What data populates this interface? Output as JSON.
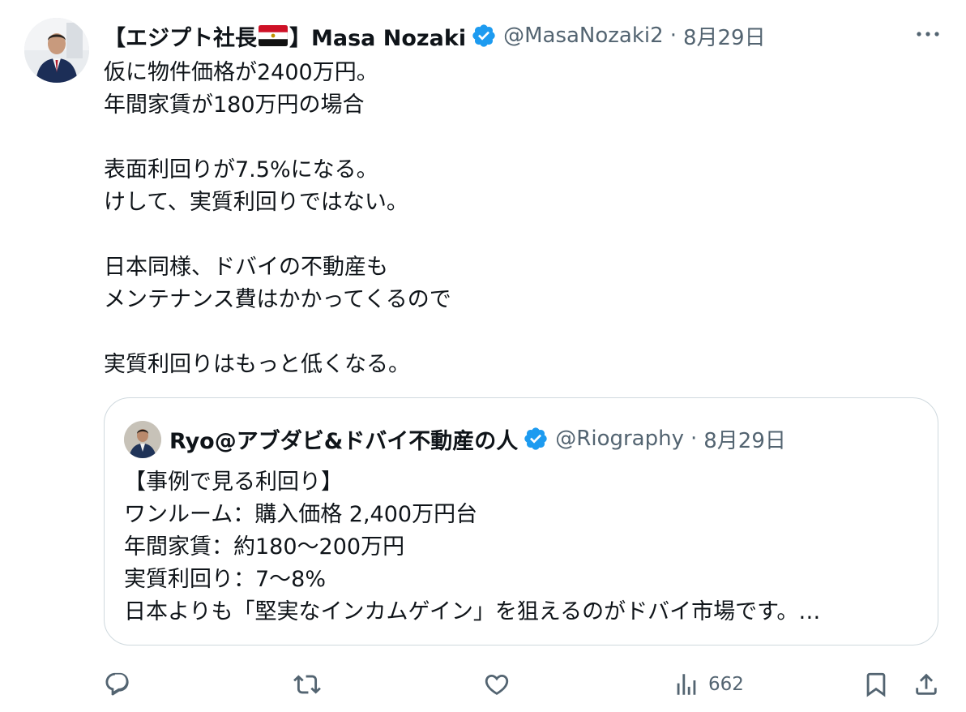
{
  "author": {
    "name_prefix": "【エジプト社長",
    "name_suffix": "】Masa Nozaki",
    "handle": "@MasaNozaki2",
    "separator": "·",
    "date": "8月29日"
  },
  "tweet": {
    "lines": [
      "仮に物件価格が2400万円。",
      "年間家賃が180万円の場合",
      "",
      "表面利回りが7.5%になる。",
      "けして、実質利回りではない。",
      "",
      "日本同様、ドバイの不動産も",
      "メンテナンス費はかかってくるので",
      "",
      "実質利回りはもっと低くなる。"
    ]
  },
  "quote": {
    "name": "Ryo@アブダビ&ドバイ不動産の人",
    "handle": "@Riography",
    "separator": "·",
    "date": "8月29日",
    "lines": [
      "【事例で見る利回り】",
      "ワンルーム：購入価格 2,400万円台",
      "年間家賃：約180〜200万円",
      "実質利回り：7〜8%",
      "日本よりも「堅実なインカムゲイン」を狙えるのがドバイ市場です。…"
    ]
  },
  "actions": {
    "views_count": "662"
  },
  "colors": {
    "text": "#0f1419",
    "secondary": "#536471",
    "border": "#cfd9de",
    "verified": "#1d9bf0"
  }
}
